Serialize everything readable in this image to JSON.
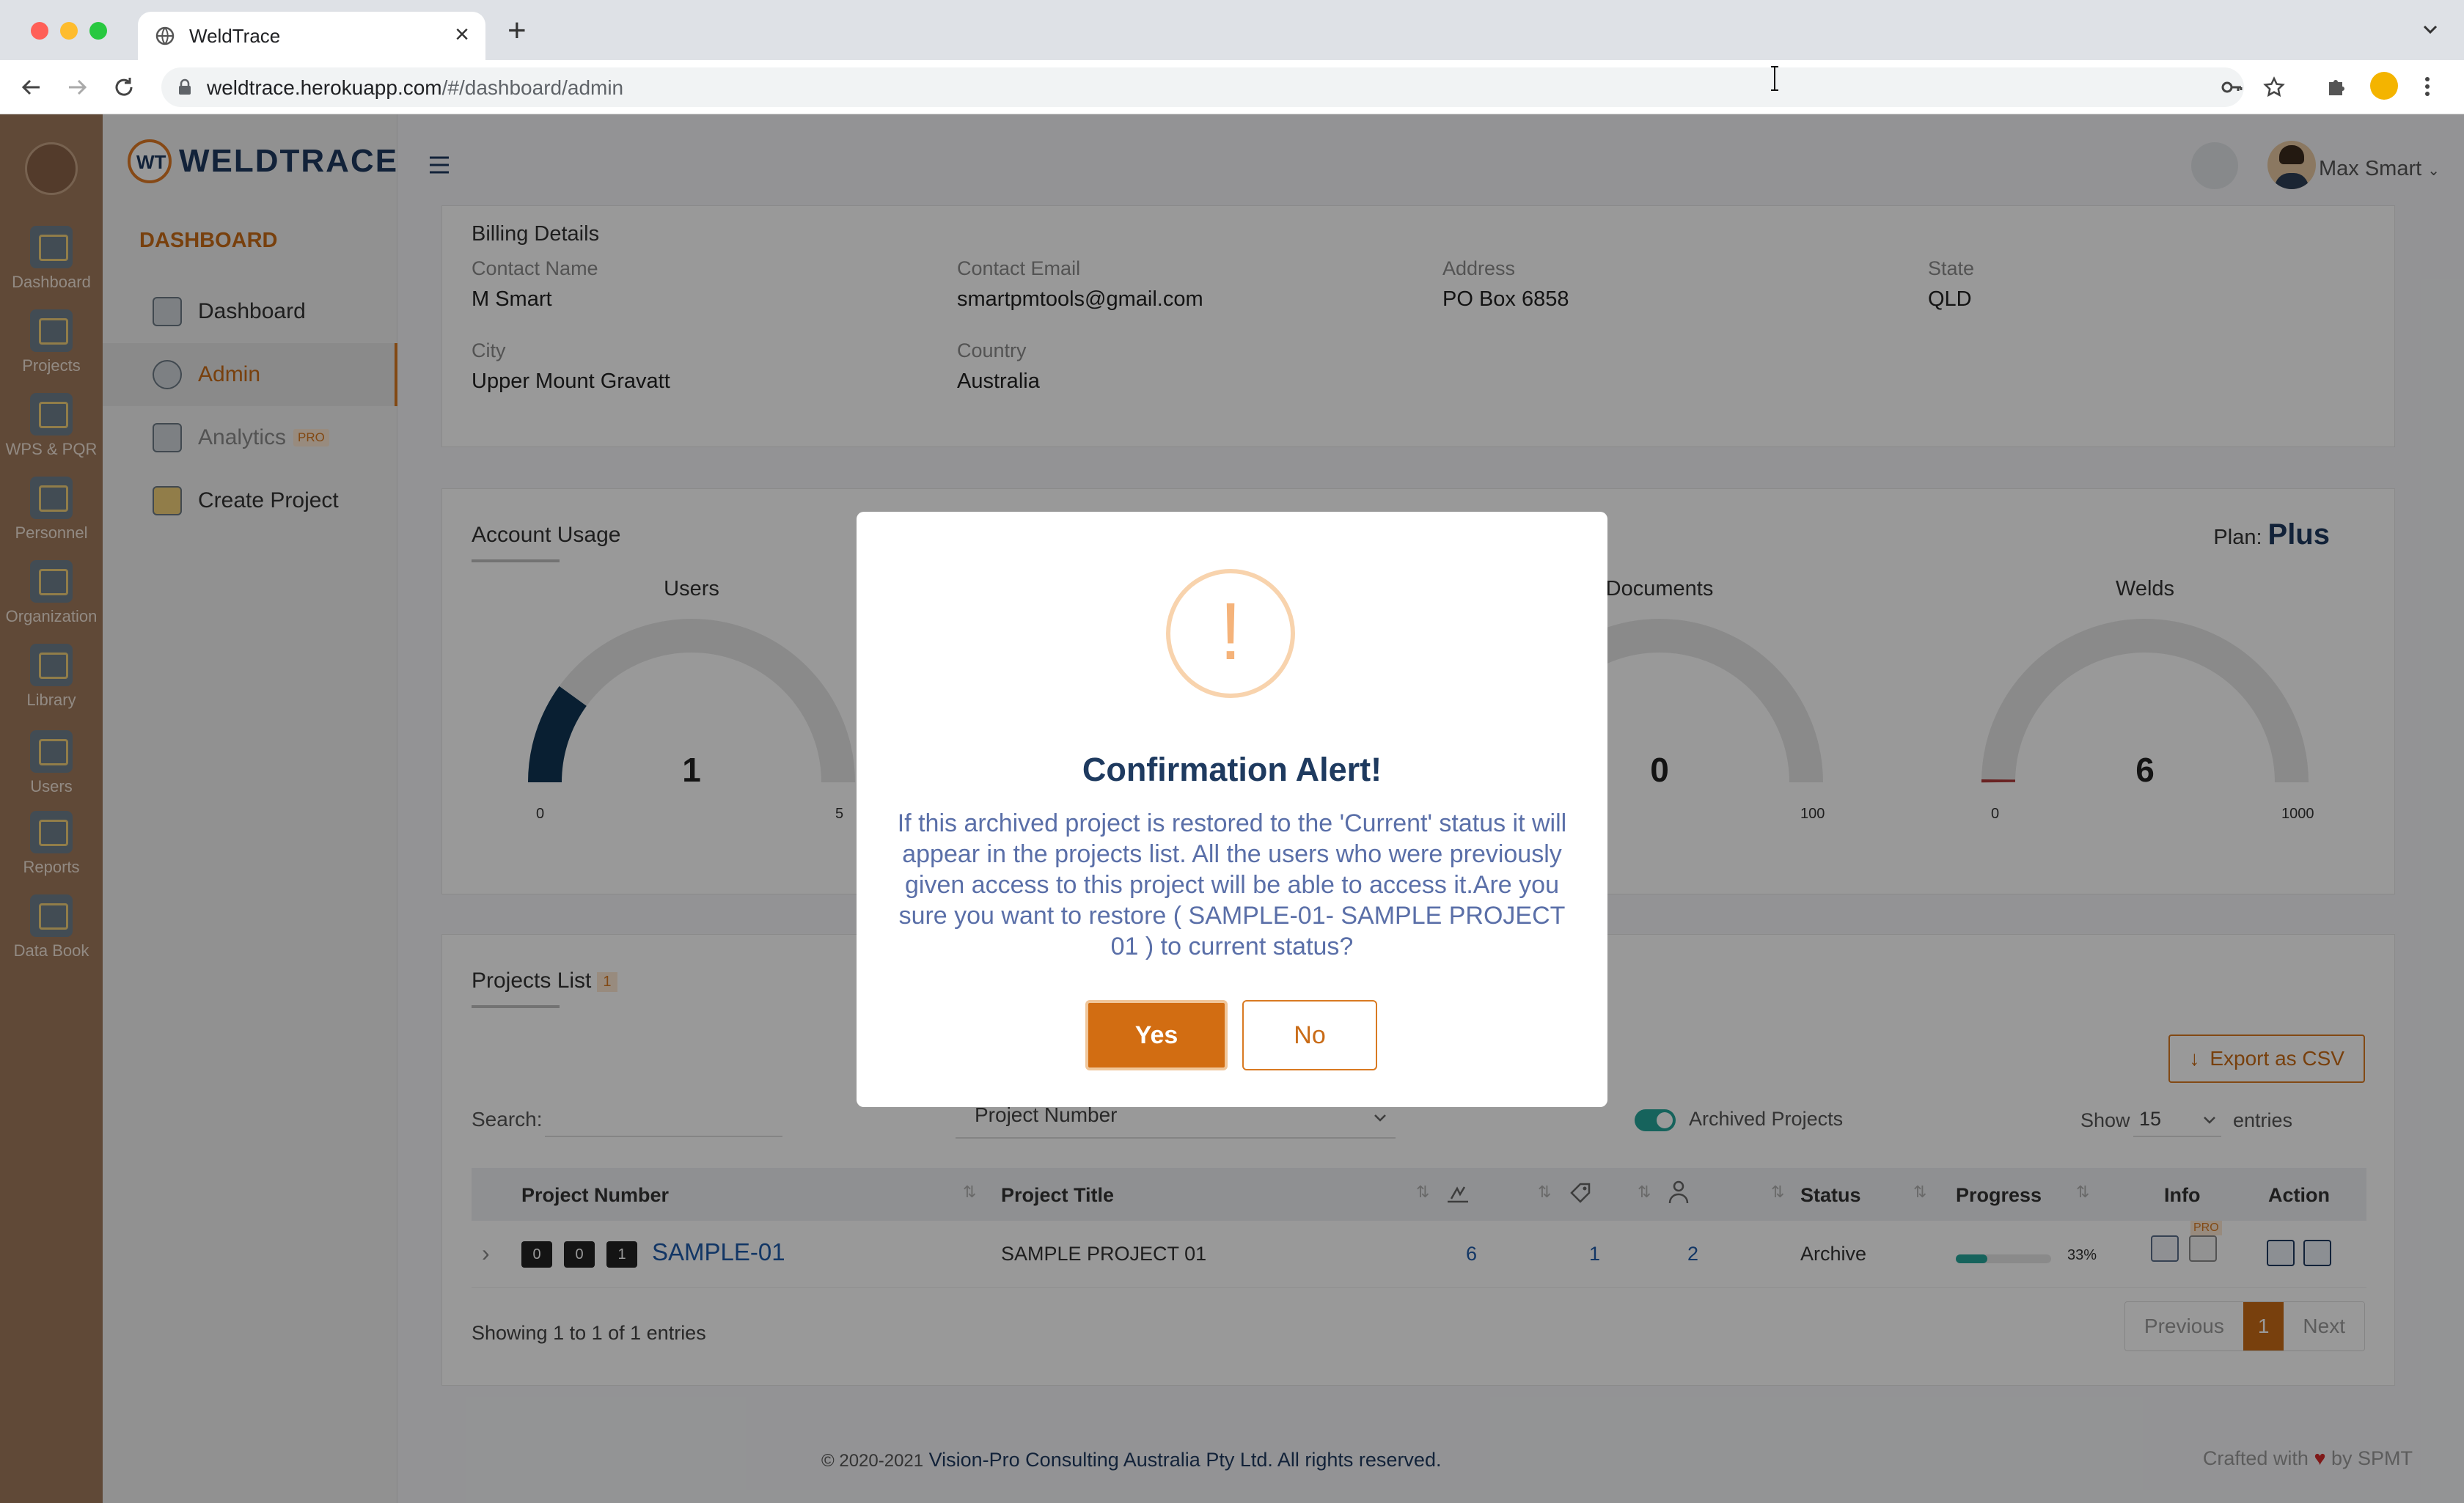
{
  "browser": {
    "tab_title": "WeldTrace",
    "url_host": "weldtrace.herokuapp.com",
    "url_path": "/#/dashboard/admin"
  },
  "rail": {
    "items": [
      {
        "label": "Dashboard",
        "icon": "dashboard-monitor-icon"
      },
      {
        "label": "Projects",
        "icon": "projects-folder-icon"
      },
      {
        "label": "WPS & PQR",
        "icon": "wps-clipboard-icon"
      },
      {
        "label": "Personnel",
        "icon": "personnel-icon"
      },
      {
        "label": "Organization",
        "icon": "organization-icon"
      },
      {
        "label": "Library",
        "icon": "library-icon"
      },
      {
        "label": "Users",
        "icon": "users-icon"
      },
      {
        "label": "Reports",
        "icon": "reports-icon"
      },
      {
        "label": "Data Book",
        "icon": "data-book-icon"
      }
    ]
  },
  "sidenav": {
    "brand_weld": "WELD",
    "brand_trace": "TRACE",
    "section_title": "DASHBOARD",
    "items": [
      {
        "label": "Dashboard"
      },
      {
        "label": "Admin"
      },
      {
        "label": "Analytics",
        "badge": "PRO"
      },
      {
        "label": "Create Project"
      }
    ]
  },
  "topbar": {
    "username": "Max Smart"
  },
  "billing": {
    "title": "Billing Details",
    "contact_name_label": "Contact Name",
    "contact_name": "M Smart",
    "contact_email_label": "Contact Email",
    "contact_email": "smartpmtools@gmail.com",
    "address_label": "Address",
    "address": "PO Box 6858",
    "state_label": "State",
    "state": "QLD",
    "city_label": "City",
    "city": "Upper Mount Gravatt",
    "country_label": "Country",
    "country": "Australia"
  },
  "usage": {
    "title": "Account Usage",
    "plan_label": "Plan:",
    "plan_value": "Plus",
    "gauges": [
      {
        "title": "Users",
        "value": "1",
        "min": "0",
        "max": "5",
        "fraction": 0.2
      },
      {
        "title": "Documents",
        "value": "0",
        "min": "0",
        "max": "100",
        "fraction": 0.0
      },
      {
        "title": "Welds",
        "value": "6",
        "min": "0",
        "max": "1000",
        "fraction": 0.006
      }
    ]
  },
  "projects": {
    "title": "Projects List",
    "count": "1",
    "export_label": "Export as CSV",
    "search_label": "Search:",
    "filter_value": "Project Number",
    "archived_label": "Archived Projects",
    "show_label": "Show",
    "show_value": "15",
    "entries_label": "entries",
    "columns": {
      "number": "Project Number",
      "title": "Project Title",
      "status": "Status",
      "progress": "Progress",
      "info": "Info",
      "action": "Action"
    },
    "row": {
      "badges": [
        "0",
        "0",
        "1"
      ],
      "number": "SAMPLE-01",
      "title": "SAMPLE PROJECT 01",
      "welds": "6",
      "docs": "1",
      "users": "2",
      "status": "Archive",
      "progress_text": "33%",
      "progress": 0.33,
      "info_pro": "PRO"
    },
    "showing": "Showing 1 to 1 of 1 entries",
    "pager": {
      "prev": "Previous",
      "current": "1",
      "next": "Next"
    }
  },
  "footer": {
    "years": "© 2020-2021",
    "company": " Vision-Pro Consulting Australia Pty Ltd. All rights reserved.",
    "crafted_pre": "Crafted with ",
    "heart": "♥",
    "crafted_post": " by SPMT"
  },
  "modal": {
    "title": "Confirmation Alert!",
    "message": "If this archived project is restored to the 'Current' status it will appear in the projects list. All the users who were previously given access to this project will be able to access it.Are you sure you want to restore ( SAMPLE-01- SAMPLE PROJECT 01 ) to current status?",
    "yes_label": "Yes",
    "no_label": "No"
  },
  "colors": {
    "accent": "#d26d12",
    "navy": "#1e3a5f",
    "teal": "#26a69a",
    "rail": "#a07a5c"
  }
}
